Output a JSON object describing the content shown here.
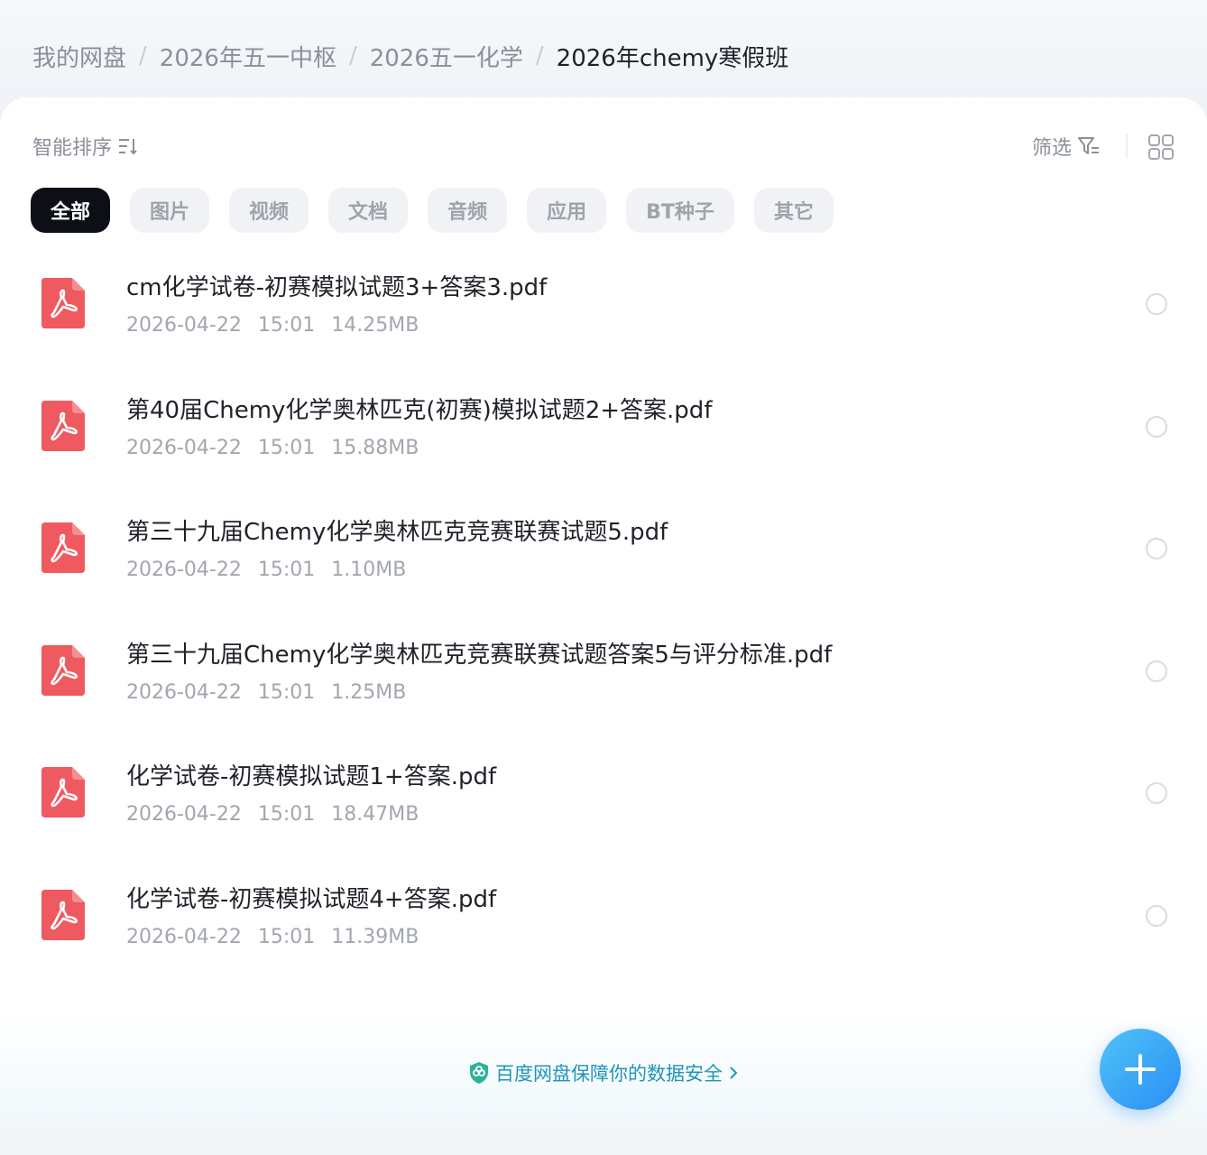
{
  "breadcrumb": {
    "items": [
      "我的网盘",
      "2026年五一中枢",
      "2026五一化学",
      "2026年chemy寒假班"
    ],
    "separator": "/"
  },
  "toolbar": {
    "sort_label": "智能排序",
    "filter_label": "筛选"
  },
  "tabs": [
    {
      "label": "全部",
      "active": true
    },
    {
      "label": "图片"
    },
    {
      "label": "视频"
    },
    {
      "label": "文档"
    },
    {
      "label": "音频"
    },
    {
      "label": "应用"
    },
    {
      "label": "BT种子"
    },
    {
      "label": "其它"
    }
  ],
  "files": [
    {
      "name": "cm化学试卷-初赛模拟试题3+答案3.pdf",
      "date": "2026-04-22",
      "time": "15:01",
      "size": "14.25MB"
    },
    {
      "name": "第40届Chemy化学奥林匹克(初赛)模拟试题2+答案.pdf",
      "date": "2026-04-22",
      "time": "15:01",
      "size": "15.88MB"
    },
    {
      "name": "第三十九届Chemy化学奥林匹克竞赛联赛试题5.pdf",
      "date": "2026-04-22",
      "time": "15:01",
      "size": "1.10MB"
    },
    {
      "name": "第三十九届Chemy化学奥林匹克竞赛联赛试题答案5与评分标准.pdf",
      "date": "2026-04-22",
      "time": "15:01",
      "size": "1.25MB"
    },
    {
      "name": "化学试卷-初赛模拟试题1+答案.pdf",
      "date": "2026-04-22",
      "time": "15:01",
      "size": "18.47MB"
    },
    {
      "name": "化学试卷-初赛模拟试题4+答案.pdf",
      "date": "2026-04-22",
      "time": "15:01",
      "size": "11.39MB"
    }
  ],
  "footer": {
    "security_text": "百度网盘保障你的数据安全"
  },
  "icons": {
    "file_type": "pdf-icon",
    "fab": "plus-icon"
  },
  "colors": {
    "pdf_red": "#ee5a5f",
    "accent_blue": "#2b8ef5",
    "security_teal": "#1f95b8",
    "active_tab": "#0c0f16"
  }
}
